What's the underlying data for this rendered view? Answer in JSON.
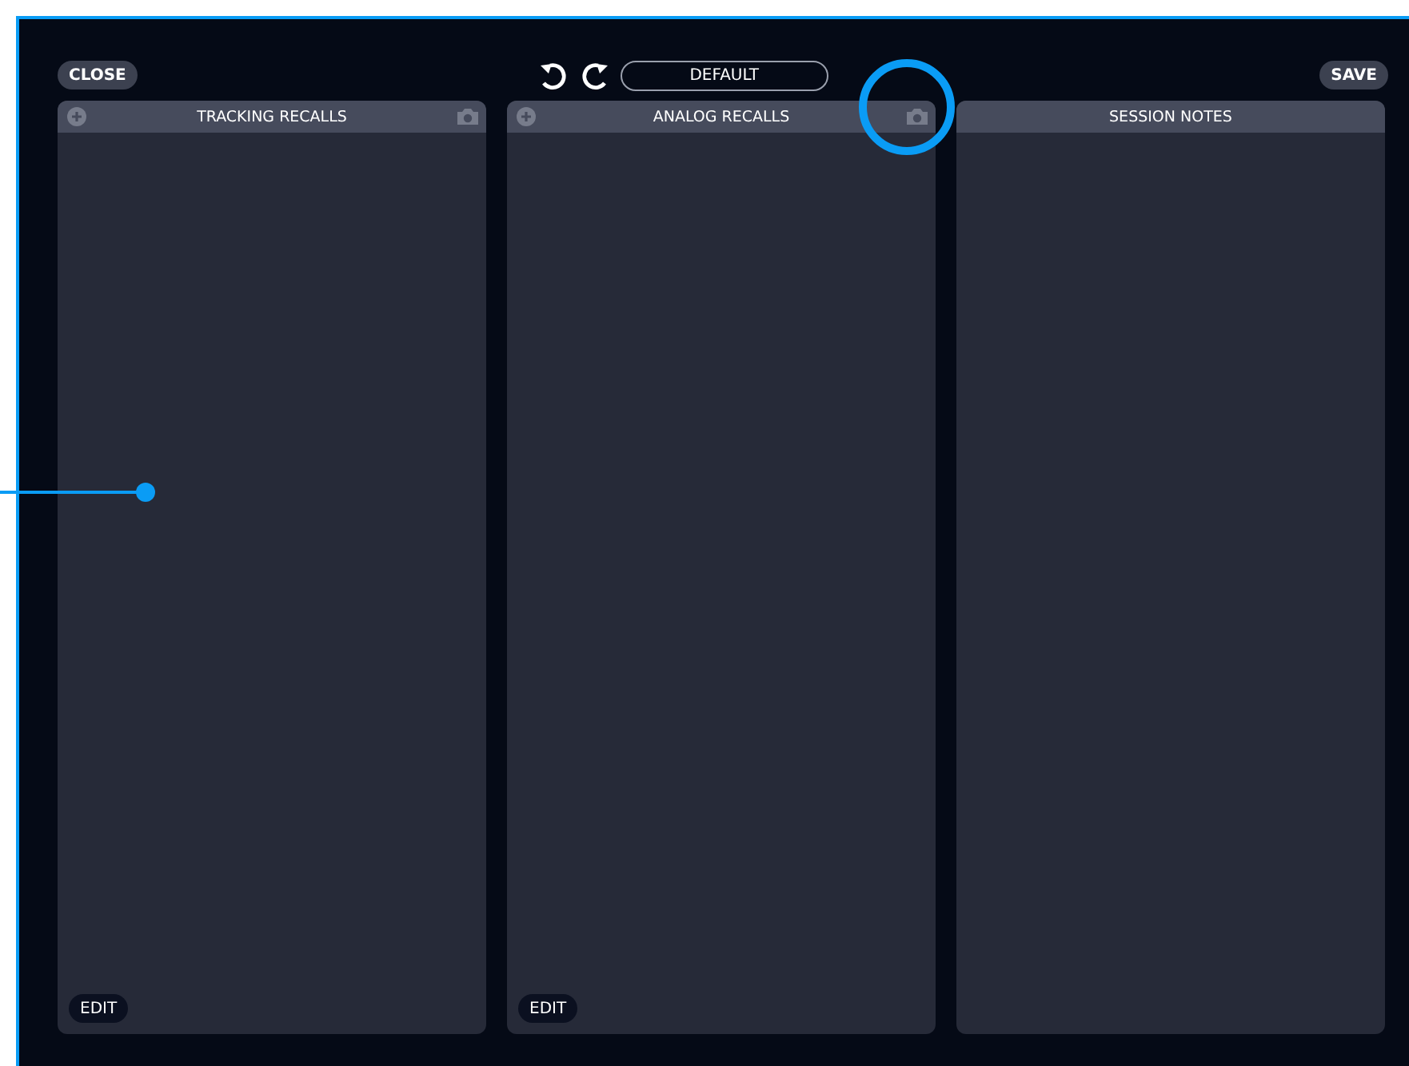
{
  "top_bar": {
    "close": "CLOSE",
    "preset": "DEFAULT",
    "save": "SAVE"
  },
  "panels": [
    {
      "title": "TRACKING RECALLS",
      "add": true,
      "camera": true,
      "edit": "EDIT"
    },
    {
      "title": "ANALOG RECALLS",
      "add": true,
      "camera": true,
      "edit": "EDIT"
    },
    {
      "title": "SESSION NOTES",
      "add": false,
      "camera": false
    }
  ]
}
